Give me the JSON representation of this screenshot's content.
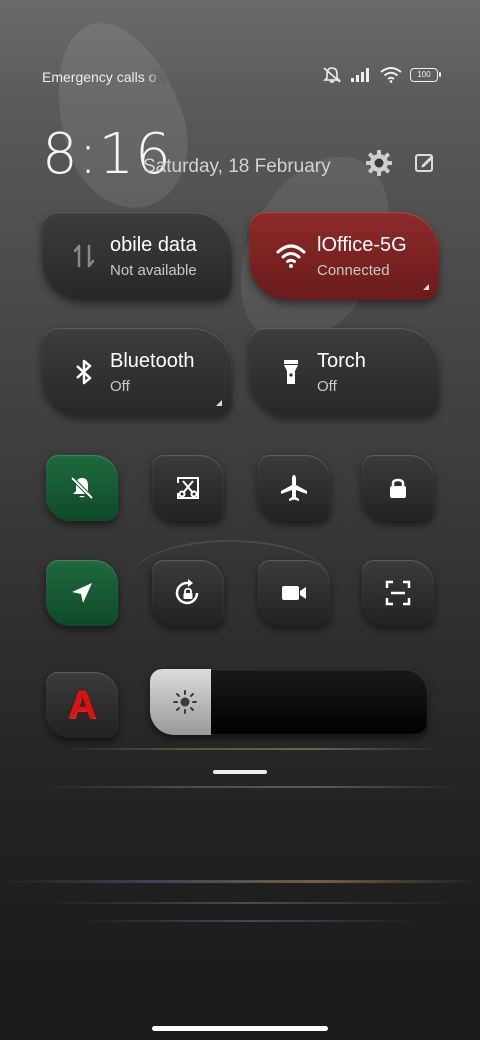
{
  "status_bar": {
    "carrier_text": "Emergency calls o",
    "battery": "100"
  },
  "header": {
    "time": "8:16",
    "date": "Saturday, 18 February"
  },
  "big_tiles": [
    {
      "title": "obile data",
      "subtitle": "Not available",
      "icon": "mobile-data-icon"
    },
    {
      "title": "lOffice-5G",
      "subtitle": "Connected",
      "icon": "wifi-icon",
      "accent": "#8e2a2a"
    },
    {
      "title": "Bluetooth",
      "subtitle": "Off",
      "icon": "bluetooth-icon"
    },
    {
      "title": "Torch",
      "subtitle": "Off",
      "icon": "torch-icon"
    }
  ],
  "small_tiles": [
    {
      "icon": "mute-bell-icon",
      "active": true,
      "accent": "#1e6a3e"
    },
    {
      "icon": "screenshot-icon"
    },
    {
      "icon": "airplane-icon"
    },
    {
      "icon": "lock-icon"
    },
    {
      "icon": "location-icon",
      "active": true,
      "accent": "#1e6a3e"
    },
    {
      "icon": "rotation-lock-icon"
    },
    {
      "icon": "video-camera-icon"
    },
    {
      "icon": "scan-icon"
    },
    {
      "icon": "font-a-icon",
      "label": "A"
    }
  ],
  "brightness": {
    "icon": "sun-icon",
    "level": 0.22
  }
}
